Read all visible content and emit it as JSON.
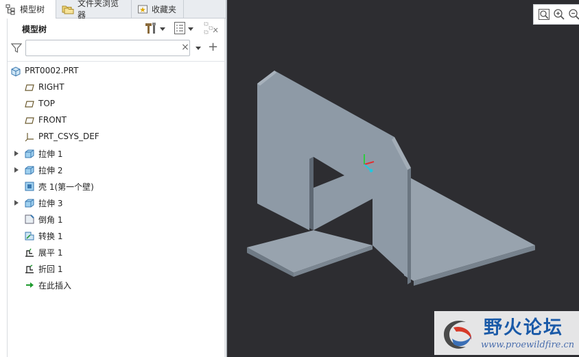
{
  "tabs": [
    {
      "label": "模型树",
      "icon": "model-tree-icon",
      "active": true
    },
    {
      "label": "文件夹浏览器",
      "icon": "folder-browser-icon",
      "active": false
    },
    {
      "label": "收藏夹",
      "icon": "favorites-icon",
      "active": false
    }
  ],
  "panel": {
    "title": "模型树",
    "settings_icon": "tools-icon",
    "show_icon": "list-view-icon",
    "filter_icon": "funnel-icon"
  },
  "search": {
    "value": "",
    "placeholder": ""
  },
  "tree": {
    "root": "PRT0002.PRT",
    "items": [
      {
        "label": "RIGHT",
        "icon": "datum-plane-icon",
        "expandable": false
      },
      {
        "label": "TOP",
        "icon": "datum-plane-icon",
        "expandable": false
      },
      {
        "label": "FRONT",
        "icon": "datum-plane-icon",
        "expandable": false
      },
      {
        "label": "PRT_CSYS_DEF",
        "icon": "csys-icon",
        "expandable": false
      },
      {
        "label": "拉伸 1",
        "icon": "extrude-icon",
        "expandable": true
      },
      {
        "label": "拉伸 2",
        "icon": "extrude-icon",
        "expandable": true
      },
      {
        "label": "壳 1(第一个壁)",
        "icon": "shell-icon",
        "expandable": false
      },
      {
        "label": "拉伸 3",
        "icon": "extrude-icon",
        "expandable": true
      },
      {
        "label": "倒角 1",
        "icon": "chamfer-icon",
        "expandable": false
      },
      {
        "label": "转换 1",
        "icon": "convert-icon",
        "expandable": false
      },
      {
        "label": "展平 1",
        "icon": "unbend-icon",
        "expandable": false
      },
      {
        "label": "折回 1",
        "icon": "bend-back-icon",
        "expandable": false
      },
      {
        "label": "在此插入",
        "icon": "insert-here-icon",
        "expandable": false
      }
    ]
  },
  "viewport": {
    "background": "#2d2d31",
    "part_color": "#8e9aa6",
    "toolbar": [
      "zoom-fit-icon",
      "zoom-in-icon",
      "zoom-out-icon"
    ]
  },
  "watermark": {
    "title": "野火论坛",
    "url": "www.proewildfire.cn"
  }
}
